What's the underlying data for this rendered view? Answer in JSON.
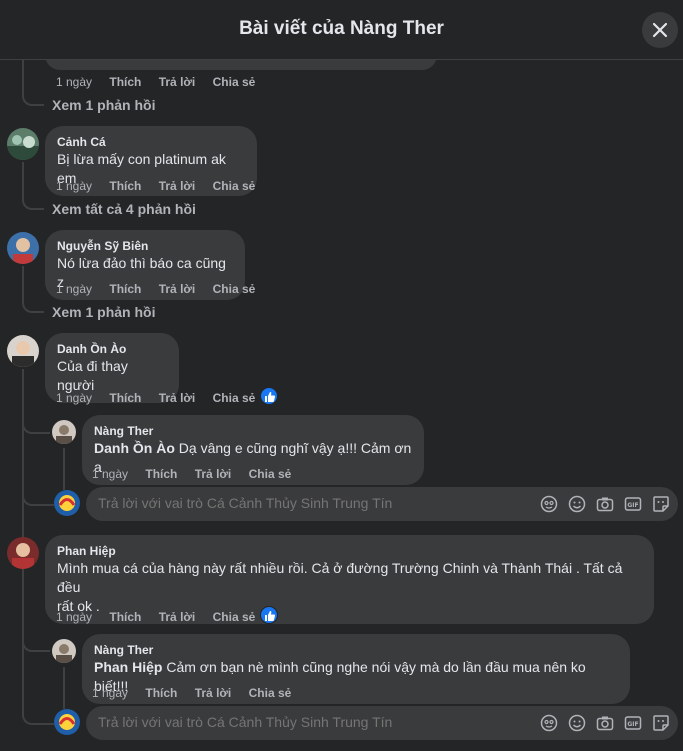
{
  "header": {
    "title": "Bài viết của Nàng Ther"
  },
  "top_row": {
    "time": "1 ngày",
    "like": "Thích",
    "reply": "Trả lời",
    "share": "Chia sẻ",
    "view_replies": "Xem 1 phản hồi"
  },
  "comments": [
    {
      "author": "Cảnh Cá",
      "text": "Bị lừa mấy con platinum ak em",
      "time": "1 ngày",
      "like": "Thích",
      "reply": "Trả lời",
      "share": "Chia sẻ",
      "view_replies": "Xem tất cả 4 phản hồi"
    },
    {
      "author": "Nguyễn Sỹ Biên",
      "text": "Nó lừa đảo thì báo ca cũng z",
      "time": "1 ngày",
      "like": "Thích",
      "reply": "Trả lời",
      "share": "Chia sẻ",
      "view_replies": "Xem 1 phản hồi"
    },
    {
      "author": "Danh Ồn Ào",
      "text": "Của đi thay người",
      "time": "1 ngày",
      "like": "Thích",
      "reply": "Trả lời",
      "share": "Chia sẻ",
      "reply_item": {
        "author": "Nàng Ther",
        "mention": "Danh Ồn Ào",
        "text": " Dạ vâng e cũng nghĩ vậy ạ!!! Cảm ơn a",
        "time": "1 ngày",
        "like": "Thích",
        "reply": "Trả lời",
        "share": "Chia sẻ"
      }
    },
    {
      "author": "Phan Hiệp",
      "text_line1": "Mình mua cá của hàng này rất nhiều rồi. Cả ở đường Trường Chinh và Thành Thái . Tất cả đều",
      "text_line2": "rất ok .",
      "time": "1 ngày",
      "like": "Thích",
      "reply": "Trả lời",
      "share": "Chia sẻ",
      "reply_item": {
        "author": "Nàng Ther",
        "mention": "Phan Hiệp",
        "text": " Cảm ơn bạn nè mình cũng nghe nói vậy mà do lần đầu mua nên ko biết!!!",
        "time": "1 ngày",
        "like": "Thích",
        "reply": "Trả lời",
        "share": "Chia sẻ"
      }
    }
  ],
  "reply_box": {
    "placeholder": "Trả lời với vai trò Cá Cảnh Thủy Sinh Trung Tín"
  },
  "icons": [
    "close-icon",
    "like-reaction-icon",
    "avatar-icon",
    "sticker-icon",
    "emoji-icon",
    "camera-icon",
    "gif-icon",
    "sticker-note-icon"
  ],
  "colors": {
    "background": "#242526",
    "bubble": "#3a3b3c",
    "like_blue": "#1877f2"
  }
}
